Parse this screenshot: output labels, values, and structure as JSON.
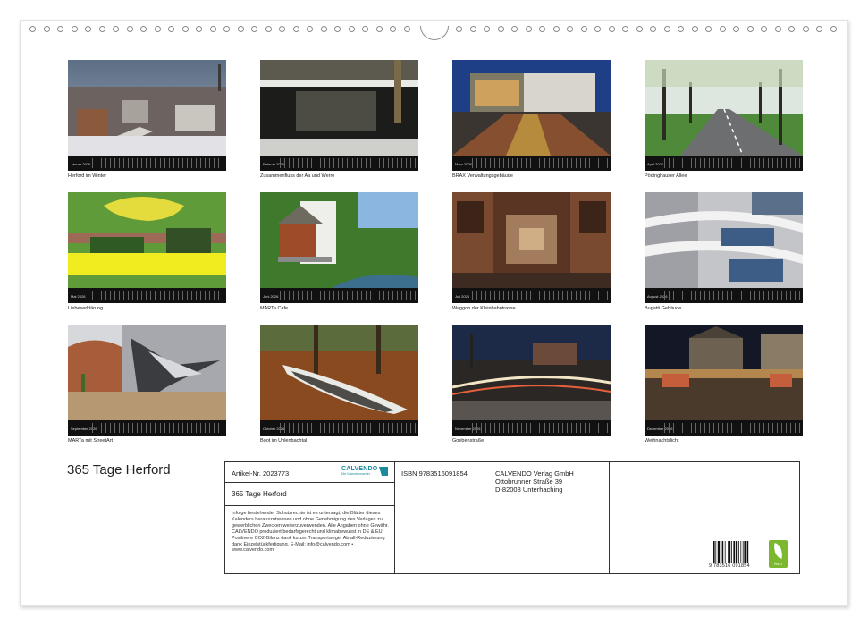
{
  "calendar": {
    "title": "365 Tage Herford",
    "months": [
      {
        "name": "Januar 2026",
        "caption": "Herford im Winter"
      },
      {
        "name": "Februar 2026",
        "caption": "Zusammenfluss der Aa und Werre"
      },
      {
        "name": "März 2026",
        "caption": "BRAX Verwaltungsgebäude"
      },
      {
        "name": "April 2026",
        "caption": "Pödinghauser Allee"
      },
      {
        "name": "Mai 2026",
        "caption": "Liebeserklärung"
      },
      {
        "name": "Juni 2026",
        "caption": "MARTa Cafe"
      },
      {
        "name": "Juli 2026",
        "caption": "Waggon der Kleinbahntrasse"
      },
      {
        "name": "August 2026",
        "caption": "Bugatti Gebäude"
      },
      {
        "name": "September 2026",
        "caption": "MARTa mit StreetArt"
      },
      {
        "name": "Oktober 2026",
        "caption": "Boot im Uhlenbachtal"
      },
      {
        "name": "November 2026",
        "caption": "Goebenstraße"
      },
      {
        "name": "Dezember 2026",
        "caption": "Weihnachtslicht"
      }
    ]
  },
  "info": {
    "article": "Artikel-Nr. 2023773",
    "brand_name": "CALVENDO",
    "brand_tagline": "Die Kalendermacher",
    "subtitle": "365 Tage Herford",
    "legal": "Infolge bestehender Schutzrechte ist es untersagt, die Blätter dieses Kalenders herauszutrennen und ohne Genehmigung des Verlages zu gewerblichen Zwecken weiterzuverwenden. Alle Angaben ohne Gewähr. CALVENDO produziert bedarfsgerecht und klimabewusst in DE & EU. Positivere CO2-Bilanz dank kurzer Transportwege. Abfall-Reduzierung dank Einzelstückfertigung. E-Mail: info@calvendo.com • www.calvendo.com",
    "isbn": "ISBN 9783516091854",
    "publisher_lines": [
      "CALVENDO Verlag GmbH",
      "Ottobrunner Straße 39",
      "D-82008 Unterhaching"
    ],
    "barcode_number": "9 783516 091854",
    "eco_label": "feco"
  }
}
